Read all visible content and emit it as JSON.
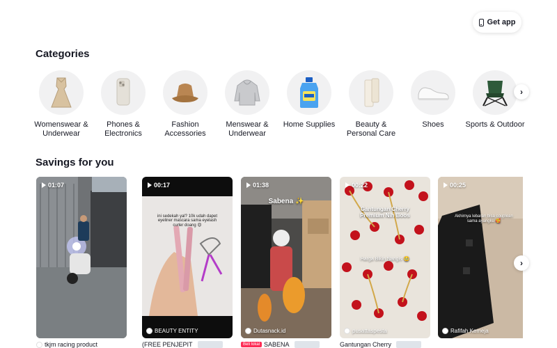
{
  "header": {
    "get_app_label": "Get app"
  },
  "categories": {
    "title": "Categories",
    "items": [
      {
        "label": "Womenswear & Underwear",
        "icon": "dress-icon"
      },
      {
        "label": "Phones & Electronics",
        "icon": "phone-icon"
      },
      {
        "label": "Fashion Accessories",
        "icon": "bucket-hat-icon"
      },
      {
        "label": "Menswear & Underwear",
        "icon": "hoodie-icon"
      },
      {
        "label": "Home Supplies",
        "icon": "detergent-icon"
      },
      {
        "label": "Beauty & Personal Care",
        "icon": "skincare-bottle-icon"
      },
      {
        "label": "Shoes",
        "icon": "sneaker-icon"
      },
      {
        "label": "Sports & Outdoor",
        "icon": "camping-chair-icon"
      }
    ]
  },
  "savings": {
    "title": "Savings for you",
    "videos": [
      {
        "duration": "01:07",
        "shop": "",
        "overlay": "",
        "product": "tkjm racing product",
        "badge": ""
      },
      {
        "duration": "00:17",
        "shop": "BEAUTY ENTITY",
        "overlay": "ini sedekah yal? 10k udah dapet eyeliner mascara sama eyelash curler doang 😍",
        "product": "(FREE PENJEPIT",
        "badge": ""
      },
      {
        "duration": "01:38",
        "shop": "Dutasnack.id",
        "overlay": "Sabena ✨",
        "product": "SABENA",
        "badge": "Beli lokal"
      },
      {
        "duration": "00:22",
        "shop": "pusattaspesta",
        "overlay": "Gantungan Cherry Premium Nih Boos",
        "overlay2": "Harga Bikin Nangis 🥹",
        "product": "Gantungan Cherry",
        "badge": ""
      },
      {
        "duration": "00:25",
        "shop": "Rafifah Kemeja",
        "overlay": "Akhirnya lebaran bisa couplean sama ayangku 🥰",
        "product": "",
        "badge": ""
      }
    ]
  },
  "colors": {
    "accent": "#fe2c55",
    "text": "#161823",
    "circle_bg": "#f1f1f2"
  }
}
